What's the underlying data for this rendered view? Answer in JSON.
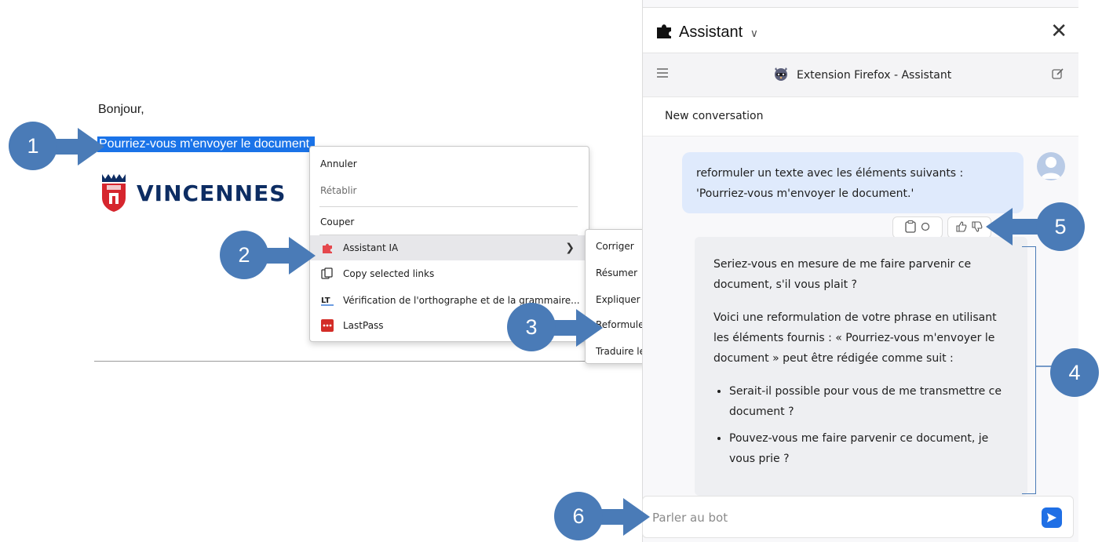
{
  "email": {
    "greeting": "Bonjour,",
    "selected_text": "Pourriez-vous m'envoyer le document.",
    "logo_text": "VINCENNES"
  },
  "context_menu": {
    "items": [
      {
        "label": "Annuler",
        "icon": "none"
      },
      {
        "label": "Rétablir",
        "icon": "none"
      },
      {
        "label": "Couper",
        "icon": "none"
      },
      {
        "label": "Assistant IA",
        "icon": "puzzle-icon"
      },
      {
        "label": "Copy selected links",
        "icon": "copy-links-icon"
      },
      {
        "label": "Vérification de l'orthographe et de la grammaire...",
        "icon": "languagetool-icon"
      },
      {
        "label": "LastPass",
        "icon": "lastpass-icon"
      }
    ],
    "submenu": [
      "Corriger",
      "Résumer",
      "Expliquer",
      "Reformuler le texte",
      "Traduire le texte"
    ]
  },
  "callouts": [
    "1",
    "2",
    "3",
    "4",
    "5",
    "6"
  ],
  "assistant": {
    "title": "Assistant",
    "subtitle": "Extension Firefox - Assistant",
    "new_conversation": "New conversation",
    "user_message": "reformuler un texte avec les éléments suivants : 'Pourriez-vous m'envoyer le document.'",
    "bot_paragraph_1": "Seriez-vous en mesure de me faire parvenir ce document, s'il vous plait ?",
    "bot_paragraph_2": "Voici une reformulation de votre phrase en utilisant les éléments fournis : « Pourriez-vous m'envoyer le document » peut être rédigée comme suit :",
    "bot_bullets": [
      "Serait-il possible pour vous de me transmettre ce document ?",
      "Pouvez-vous me faire parvenir ce document, je vous prie ?"
    ],
    "input_placeholder": "Parler au bot"
  },
  "colors": {
    "accent": "#4a7bb7",
    "selection": "#1a73e8",
    "send": "#1f6fe5",
    "logo_red": "#d6262e",
    "logo_navy": "#0d2d63"
  }
}
